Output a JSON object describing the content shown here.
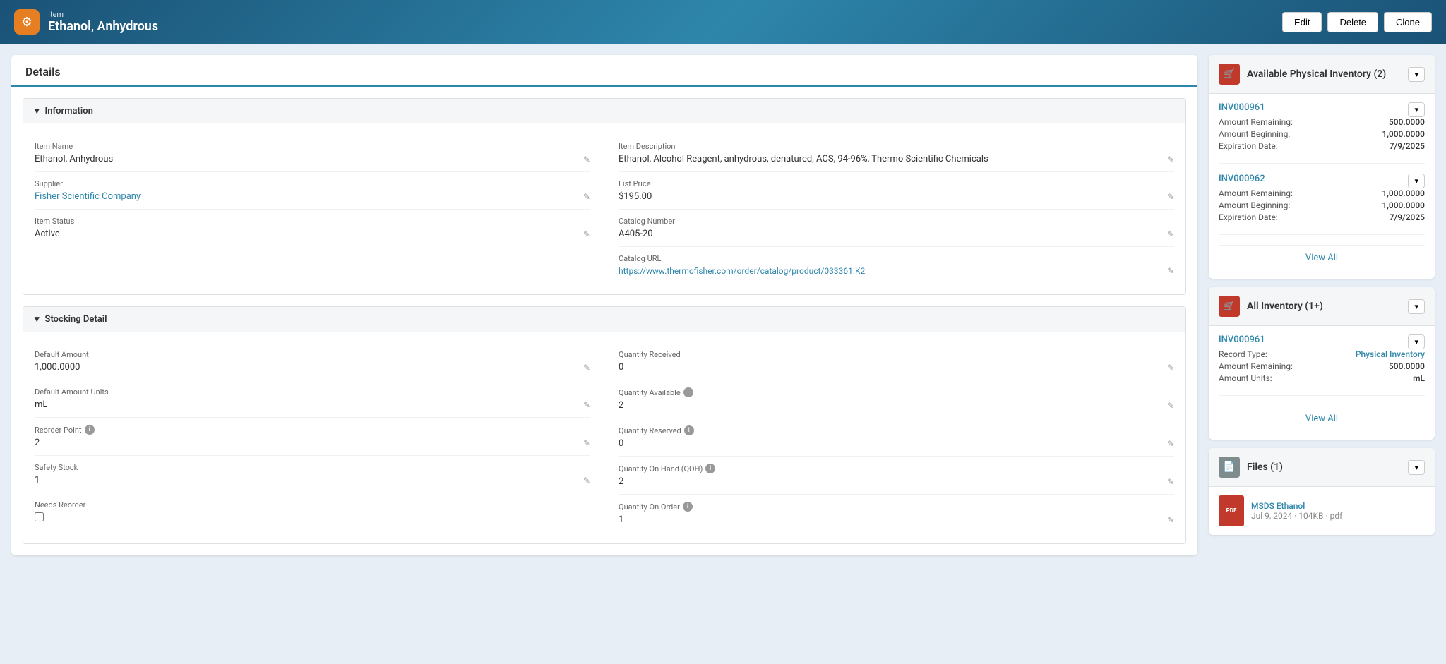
{
  "topbar": {
    "icon": "⚙",
    "item_label": "Item",
    "item_name": "Ethanol, Anhydrous",
    "btn_edit": "Edit",
    "btn_delete": "Delete",
    "btn_clone": "Clone"
  },
  "details_tab": "Details",
  "information": {
    "section_title": "Information",
    "item_name_label": "Item Name",
    "item_name_value": "Ethanol, Anhydrous",
    "supplier_label": "Supplier",
    "supplier_value": "Fisher Scientific Company",
    "item_status_label": "Item Status",
    "item_status_value": "Active",
    "item_desc_label": "Item Description",
    "item_desc_value": "Ethanol, Alcohol Reagent, anhydrous, denatured, ACS, 94-96%, Thermo Scientific Chemicals",
    "list_price_label": "List Price",
    "list_price_value": "$195.00",
    "catalog_number_label": "Catalog Number",
    "catalog_number_value": "A405-20",
    "catalog_url_label": "Catalog URL",
    "catalog_url_value": "https://www.thermofisher.com/order/catalog/product/033361.K2"
  },
  "stocking": {
    "section_title": "Stocking Detail",
    "default_amount_label": "Default Amount",
    "default_amount_value": "1,000.0000",
    "default_amount_units_label": "Default Amount Units",
    "default_amount_units_value": "mL",
    "reorder_point_label": "Reorder Point",
    "reorder_point_value": "2",
    "safety_stock_label": "Safety Stock",
    "safety_stock_value": "1",
    "needs_reorder_label": "Needs Reorder",
    "qty_received_label": "Quantity Received",
    "qty_received_value": "0",
    "qty_available_label": "Quantity Available",
    "qty_available_value": "2",
    "qty_reserved_label": "Quantity Reserved",
    "qty_reserved_value": "0",
    "qty_on_hand_label": "Quantity On Hand (QOH)",
    "qty_on_hand_value": "2",
    "qty_on_order_label": "Quantity On Order",
    "qty_on_order_value": "1"
  },
  "available_inventory": {
    "title": "Available Physical Inventory (2)",
    "entries": [
      {
        "id": "INV000961",
        "amount_remaining_label": "Amount Remaining:",
        "amount_remaining_value": "500.0000",
        "amount_beginning_label": "Amount Beginning:",
        "amount_beginning_value": "1,000.0000",
        "expiration_label": "Expiration Date:",
        "expiration_value": "7/9/2025"
      },
      {
        "id": "INV000962",
        "amount_remaining_label": "Amount Remaining:",
        "amount_remaining_value": "1,000.0000",
        "amount_beginning_label": "Amount Beginning:",
        "amount_beginning_value": "1,000.0000",
        "expiration_label": "Expiration Date:",
        "expiration_value": "7/9/2025"
      }
    ],
    "view_all": "View All"
  },
  "all_inventory": {
    "title": "All Inventory (1+)",
    "entry": {
      "id": "INV000961",
      "record_type_label": "Record Type:",
      "record_type_value": "Physical Inventory",
      "amount_remaining_label": "Amount Remaining:",
      "amount_remaining_value": "500.0000",
      "amount_units_label": "Amount Units:",
      "amount_units_value": "mL"
    },
    "view_all": "View All"
  },
  "files": {
    "title": "Files (1)",
    "entry": {
      "name": "MSDS Ethanol",
      "meta": "Jul 9, 2024 · 104KB · pdf"
    }
  }
}
